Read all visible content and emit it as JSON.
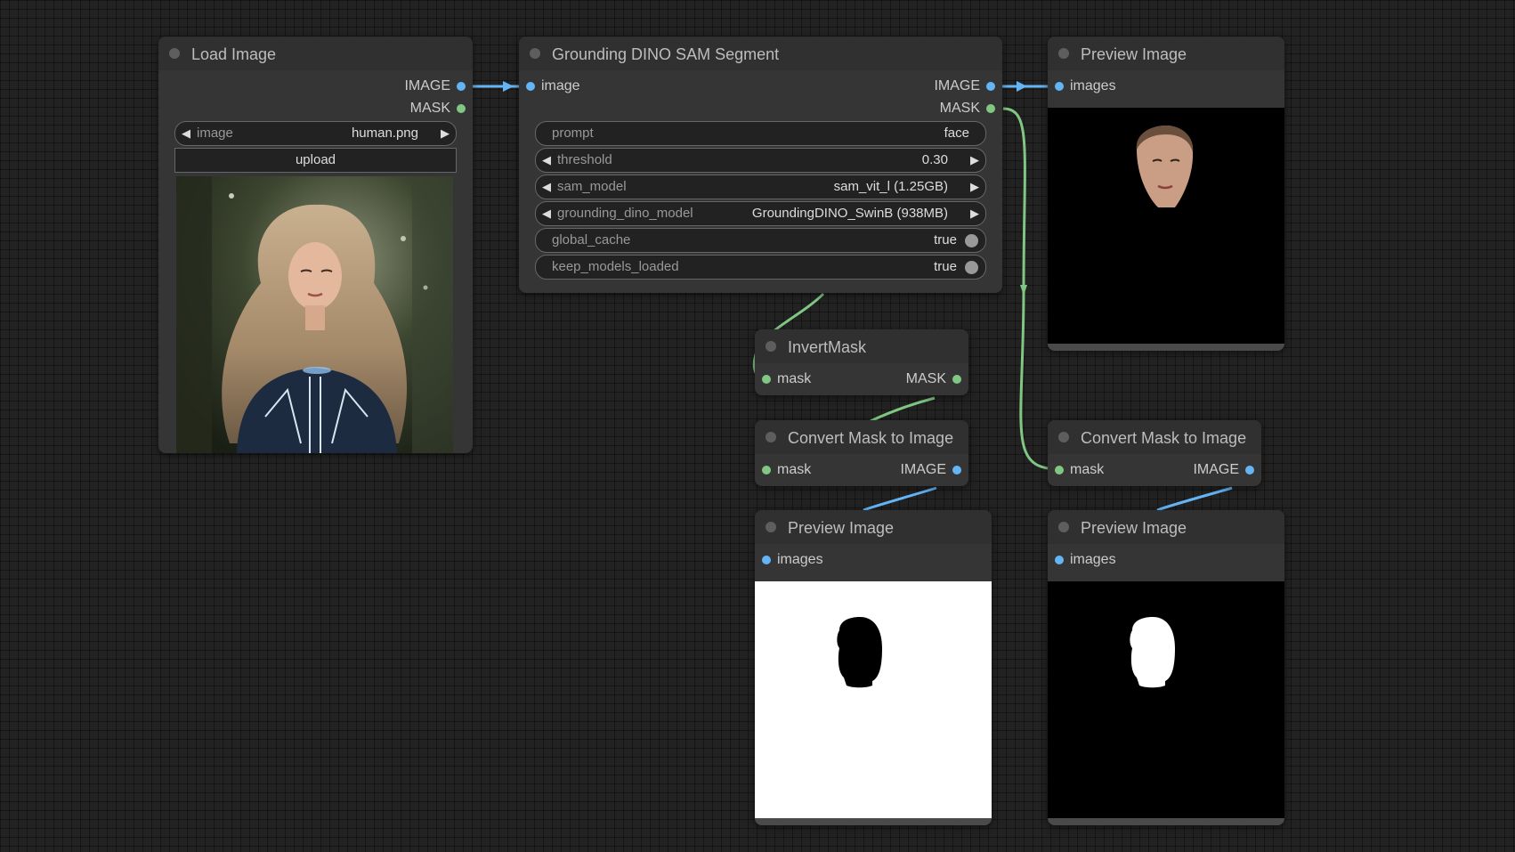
{
  "colors": {
    "canvas": "#222222",
    "node_bg": "#353535",
    "node_title_bg": "#303030",
    "image_link": "#64b5f6",
    "mask_link": "#81c784"
  },
  "nodes": {
    "load_image": {
      "title": "Load Image",
      "outputs": [
        "IMAGE",
        "MASK"
      ],
      "image_widget": {
        "label": "image",
        "value": "human.png"
      },
      "upload_label": "upload",
      "preview": "photo of a woman with long blonde hair in a dark futuristic suit in a forest"
    },
    "grounding": {
      "title": "Grounding DINO SAM Segment",
      "input": "image",
      "outputs": [
        "IMAGE",
        "MASK"
      ],
      "widgets": {
        "prompt": {
          "label": "prompt",
          "value": "face"
        },
        "threshold": {
          "label": "threshold",
          "value": "0.30"
        },
        "sam_model": {
          "label": "sam_model",
          "value": "sam_vit_l (1.25GB)"
        },
        "grounding_dino_model": {
          "label": "grounding_dino_model",
          "value": "GroundingDINO_SwinB (938MB)"
        },
        "global_cache": {
          "label": "global_cache",
          "value": "true"
        },
        "keep_models_loaded": {
          "label": "keep_models_loaded",
          "value": "true"
        }
      }
    },
    "preview_top": {
      "title": "Preview Image",
      "input": "images",
      "preview": "segmented face on black background"
    },
    "invert_mask": {
      "title": "InvertMask",
      "input": "mask",
      "output": "MASK"
    },
    "convert_left": {
      "title": "Convert Mask to Image",
      "input": "mask",
      "output": "IMAGE"
    },
    "convert_right": {
      "title": "Convert Mask to Image",
      "input": "mask",
      "output": "IMAGE"
    },
    "preview_left": {
      "title": "Preview Image",
      "input": "images",
      "preview": "inverted mask: black head shape on white"
    },
    "preview_right": {
      "title": "Preview Image",
      "input": "images",
      "preview": "mask: white head shape on black"
    }
  },
  "icons": {
    "arrow_left": "◀",
    "arrow_right": "▶"
  }
}
